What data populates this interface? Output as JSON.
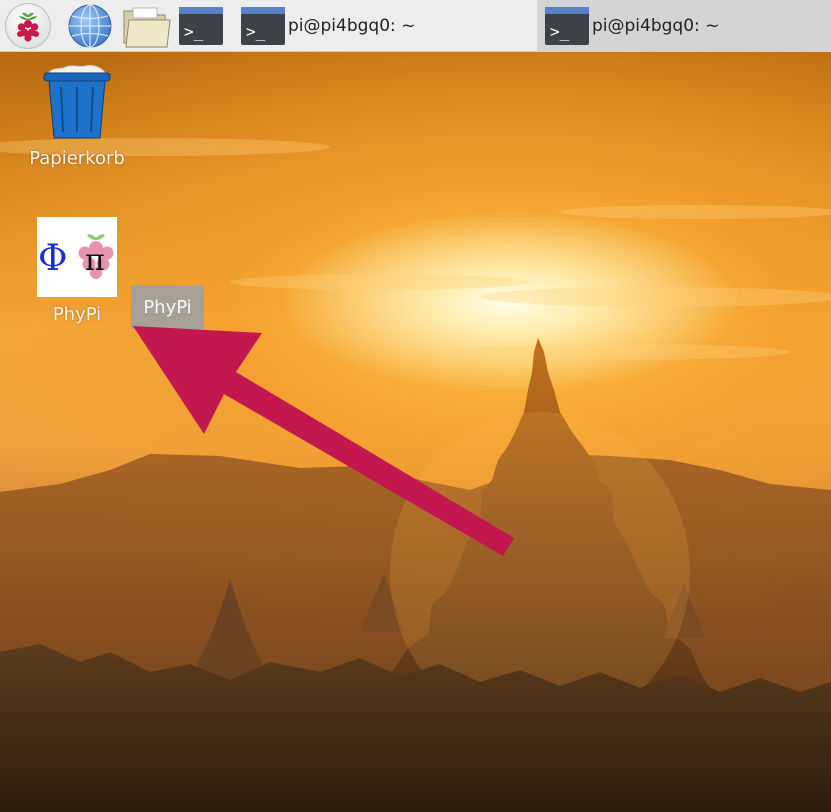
{
  "taskbar": {
    "launchers": [
      {
        "icon": "raspberry-menu-icon"
      },
      {
        "icon": "web-browser-globe-icon"
      },
      {
        "icon": "file-manager-folder-icon"
      },
      {
        "icon": "terminal-icon"
      }
    ],
    "tasks": [
      {
        "label": "pi@pi4bgq0: ~",
        "icon": "terminal-icon",
        "active": false
      },
      {
        "label": "pi@pi4bgq0: ~",
        "icon": "terminal-icon",
        "active": true
      }
    ]
  },
  "desktop": {
    "icons": [
      {
        "label": "Papierkorb",
        "icon": "trash-bin-icon"
      },
      {
        "label": "PhyPi",
        "icon": "phypi-app-icon",
        "glyphs": [
          "Φ",
          "π"
        ]
      }
    ],
    "tooltip": {
      "text": "PhyPi"
    },
    "annotation": {
      "type": "arrow",
      "color": "#c2174f"
    }
  },
  "colors": {
    "taskbar_bg": "#ededed",
    "active_task_bg": "#d4d4d4",
    "arrow": "#c2174f",
    "tooltip_bg": "#a0a0a0"
  }
}
